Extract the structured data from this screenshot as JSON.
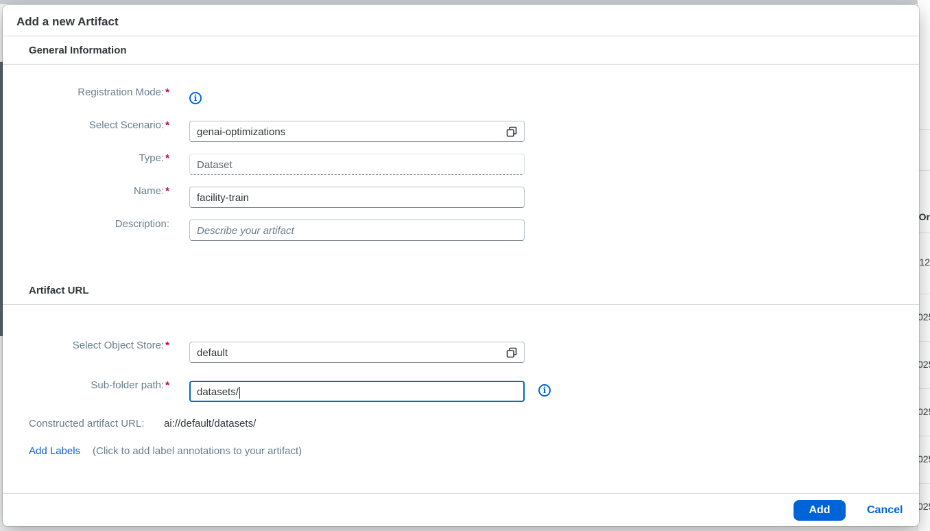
{
  "dialog": {
    "title": "Add a new Artifact"
  },
  "general": {
    "section_title": "General Information",
    "registration_mode_label": "Registration Mode:",
    "select_scenario_label": "Select Scenario:",
    "select_scenario_value": "genai-optimizations",
    "type_label": "Type:",
    "type_value": "Dataset",
    "name_label": "Name:",
    "name_value": "facility-train",
    "description_label": "Description:",
    "description_placeholder": "Describe your artifact",
    "required_marker": "*"
  },
  "artifact_url": {
    "section_title": "Artifact URL",
    "object_store_label": "Select Object Store:",
    "object_store_value": "default",
    "subfolder_label": "Sub-folder path:",
    "subfolder_value": "datasets/",
    "constructed_label": "Constructed artifact URL:",
    "constructed_value": "ai://default/datasets/",
    "add_labels_link": "Add Labels",
    "add_labels_hint": "(Click to add label annotations to your artifact)"
  },
  "footer": {
    "add_label": "Add",
    "cancel_label": "Cancel"
  },
  "background": {
    "fragments": [
      "Or",
      "12",
      "025",
      "025",
      "025",
      "025",
      "025"
    ]
  },
  "colors": {
    "accent": "#0064d9",
    "required": "#b8005c"
  },
  "icons": {
    "value_help": "value-help-icon",
    "info": "info-icon"
  }
}
